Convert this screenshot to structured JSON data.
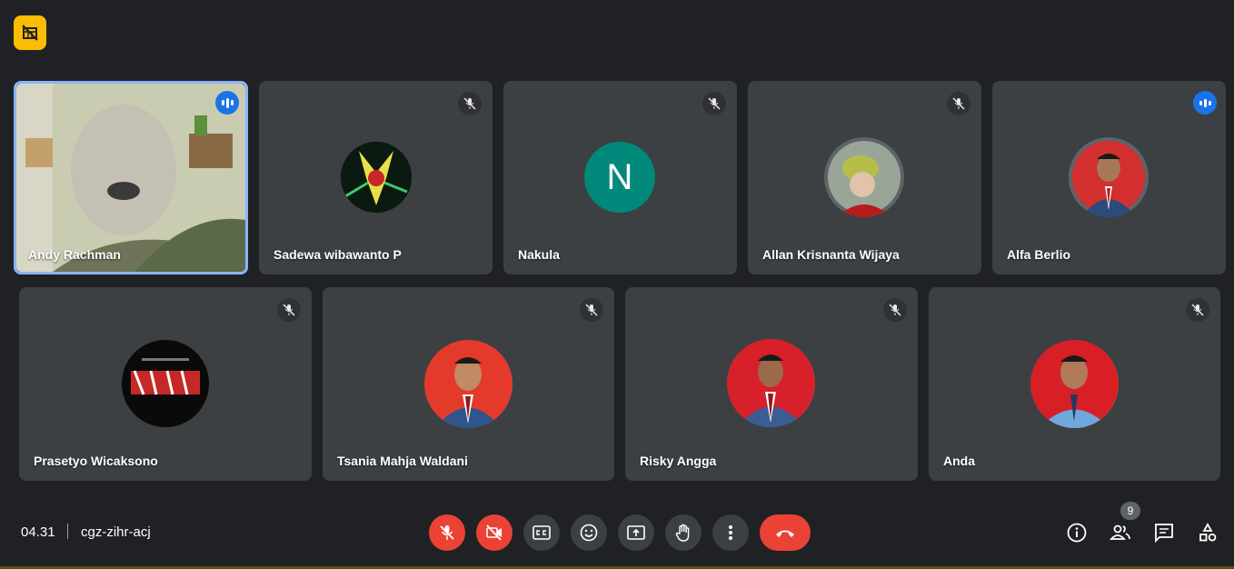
{
  "participants": [
    {
      "name": "Andy Rachman",
      "status": "speaking",
      "media": "video"
    },
    {
      "name": "Sadewa wibawanto P",
      "status": "muted",
      "media": "avatar-image"
    },
    {
      "name": "Nakula",
      "status": "muted",
      "media": "initial",
      "initial": "N",
      "color": "#00897b"
    },
    {
      "name": "Allan Krisnanta Wijaya",
      "status": "muted",
      "media": "avatar-image"
    },
    {
      "name": "Alfa Berlio",
      "status": "speaking",
      "media": "avatar-image"
    },
    {
      "name": "Prasetyo Wicaksono",
      "status": "muted",
      "media": "avatar-image"
    },
    {
      "name": "Tsania Mahja Waldani",
      "status": "muted",
      "media": "avatar-image"
    },
    {
      "name": "Risky Angga",
      "status": "muted",
      "media": "avatar-image"
    },
    {
      "name": "Anda",
      "status": "muted",
      "media": "avatar-image"
    }
  ],
  "meeting": {
    "time": "04.31",
    "code": "cgz-zihr-acj"
  },
  "people_count": "9",
  "colors": {
    "accent": "#8ab4f8",
    "danger": "#ea4335",
    "speaking": "#1a73e8",
    "recording": "#fbbc04",
    "tile": "#3c4043",
    "background": "#202124"
  },
  "controls": [
    "mic-off-icon",
    "camera-off-icon",
    "captions-icon",
    "emoji-icon",
    "present-icon",
    "raise-hand-icon",
    "more-options-icon",
    "end-call-icon"
  ],
  "right_controls": [
    "info-icon",
    "people-icon",
    "chat-icon",
    "activities-icon"
  ]
}
